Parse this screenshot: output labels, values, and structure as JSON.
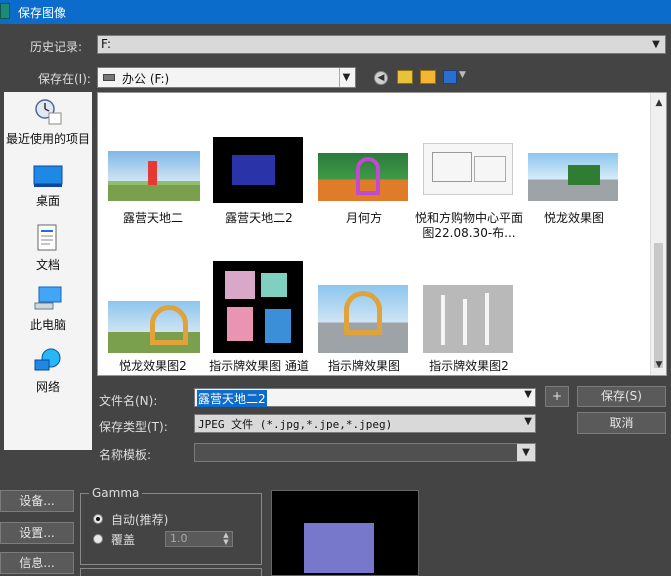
{
  "window": {
    "title": "保存图像"
  },
  "history": {
    "label": "历史记录:",
    "value": "F:"
  },
  "save_in": {
    "label": "保存在(I):",
    "value": "办公 (F:)"
  },
  "places": [
    {
      "label": "最近使用的项目",
      "icon": "recent-icon"
    },
    {
      "label": "桌面",
      "icon": "desktop-icon"
    },
    {
      "label": "文档",
      "icon": "documents-icon"
    },
    {
      "label": "此电脑",
      "icon": "computer-icon"
    },
    {
      "label": "网络",
      "icon": "network-icon"
    }
  ],
  "files": [
    {
      "name": "露营天地二"
    },
    {
      "name": "露营天地二2"
    },
    {
      "name": "月何方"
    },
    {
      "name": "悦和方购物中心平面图22.08.30-布..."
    },
    {
      "name": "悦龙效果图"
    },
    {
      "name": "悦龙效果图2"
    },
    {
      "name": "指示牌效果图 通道"
    },
    {
      "name": "指示牌效果图"
    },
    {
      "name": "指示牌效果图2"
    }
  ],
  "form": {
    "filename_label": "文件名(N):",
    "filename_value": "露营天地二2",
    "type_label": "保存类型(T):",
    "type_value": "JPEG 文件 (*.jpg,*.jpe,*.jpeg)",
    "template_label": "名称模板:",
    "template_value": "",
    "plus_label": "+",
    "save_label": "保存(S)",
    "cancel_label": "取消"
  },
  "left_buttons": {
    "setup": "设备...",
    "settings": "设置...",
    "info": "信息..."
  },
  "gamma": {
    "title": "Gamma",
    "auto_label": "自动(推荐)",
    "override_label": "覆盖",
    "override_value": "1.0",
    "selected": "auto"
  },
  "colors": {
    "accent": "#0b6ccb",
    "background": "#444444",
    "preview_rect": "#7777cc"
  }
}
